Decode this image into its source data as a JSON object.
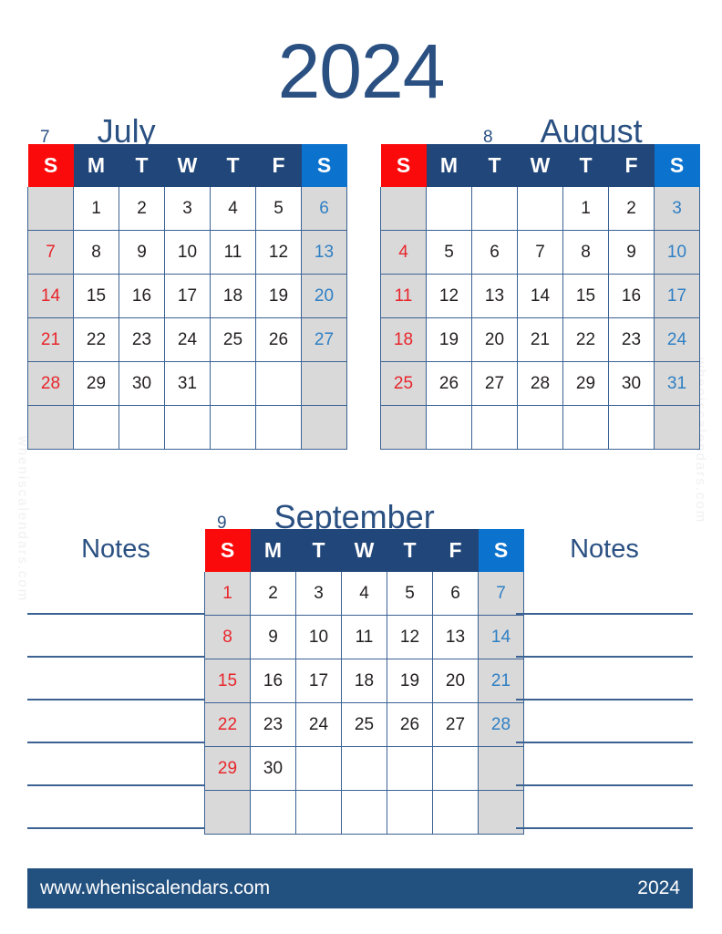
{
  "year_title": "2024",
  "weekday_headers": [
    "S",
    "M",
    "T",
    "W",
    "T",
    "F",
    "S"
  ],
  "colors": {
    "navy": "#20467A",
    "sunday_header": "#FA0A0A",
    "saturday_header": "#0B72CE",
    "weekend_cell_bg": "#D9D9D9",
    "sunday_text": "#E8252B",
    "saturday_text": "#2E7FC4",
    "weekday_text": "#231F20",
    "grid_border": "#3B6293",
    "heading_text": "#2A5082",
    "footer_bg": "#23517F"
  },
  "months": {
    "july": {
      "number": "7",
      "name": "July",
      "weeks": [
        [
          "",
          "1",
          "2",
          "3",
          "4",
          "5",
          "6"
        ],
        [
          "7",
          "8",
          "9",
          "10",
          "11",
          "12",
          "13"
        ],
        [
          "14",
          "15",
          "16",
          "17",
          "18",
          "19",
          "20"
        ],
        [
          "21",
          "22",
          "23",
          "24",
          "25",
          "26",
          "27"
        ],
        [
          "28",
          "29",
          "30",
          "31",
          "",
          "",
          ""
        ],
        [
          "",
          "",
          "",
          "",
          "",
          "",
          ""
        ]
      ]
    },
    "august": {
      "number": "8",
      "name": "August",
      "weeks": [
        [
          "",
          "",
          "",
          "",
          "1",
          "2",
          "3"
        ],
        [
          "4",
          "5",
          "6",
          "7",
          "8",
          "9",
          "10"
        ],
        [
          "11",
          "12",
          "13",
          "14",
          "15",
          "16",
          "17"
        ],
        [
          "18",
          "19",
          "20",
          "21",
          "22",
          "23",
          "24"
        ],
        [
          "25",
          "26",
          "27",
          "28",
          "29",
          "30",
          "31"
        ],
        [
          "",
          "",
          "",
          "",
          "",
          "",
          ""
        ]
      ]
    },
    "september": {
      "number": "9",
      "name": "September",
      "weeks": [
        [
          "1",
          "2",
          "3",
          "4",
          "5",
          "6",
          "7"
        ],
        [
          "8",
          "9",
          "10",
          "11",
          "12",
          "13",
          "14"
        ],
        [
          "15",
          "16",
          "17",
          "18",
          "19",
          "20",
          "21"
        ],
        [
          "22",
          "23",
          "24",
          "25",
          "26",
          "27",
          "28"
        ],
        [
          "29",
          "30",
          "",
          "",
          "",
          "",
          ""
        ],
        [
          "",
          "",
          "",
          "",
          "",
          "",
          ""
        ]
      ]
    }
  },
  "notes": {
    "left_title": "Notes",
    "right_title": "Notes",
    "line_count": 6
  },
  "watermark": {
    "left_text": "wheniscalendars.com",
    "right_text": "wheniscalendars.com"
  },
  "footer": {
    "url": "www.wheniscalendars.com",
    "year": "2024"
  }
}
